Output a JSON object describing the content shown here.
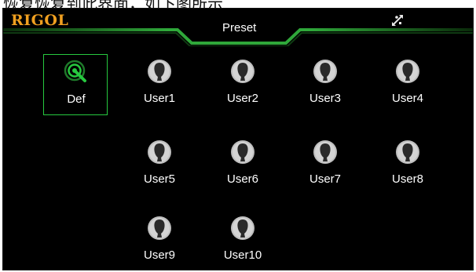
{
  "caption": "恢复恢复到此界面，如下图所示",
  "header": {
    "logo": "RIGOL",
    "title": "Preset",
    "usb_icon": "usb-icon",
    "accent_color": "#27c93f",
    "logo_color": "#f0a020"
  },
  "presets": [
    {
      "label": "Def",
      "icon": "default-target-icon",
      "selected": true
    },
    {
      "label": "User1",
      "icon": "user-icon"
    },
    {
      "label": "User2",
      "icon": "user-icon"
    },
    {
      "label": "User3",
      "icon": "user-icon"
    },
    {
      "label": "User4",
      "icon": "user-icon"
    },
    {
      "label": "User5",
      "icon": "user-icon"
    },
    {
      "label": "User6",
      "icon": "user-icon"
    },
    {
      "label": "User7",
      "icon": "user-icon"
    },
    {
      "label": "User8",
      "icon": "user-icon"
    },
    {
      "label": "User9",
      "icon": "user-icon"
    },
    {
      "label": "User10",
      "icon": "user-icon"
    }
  ]
}
